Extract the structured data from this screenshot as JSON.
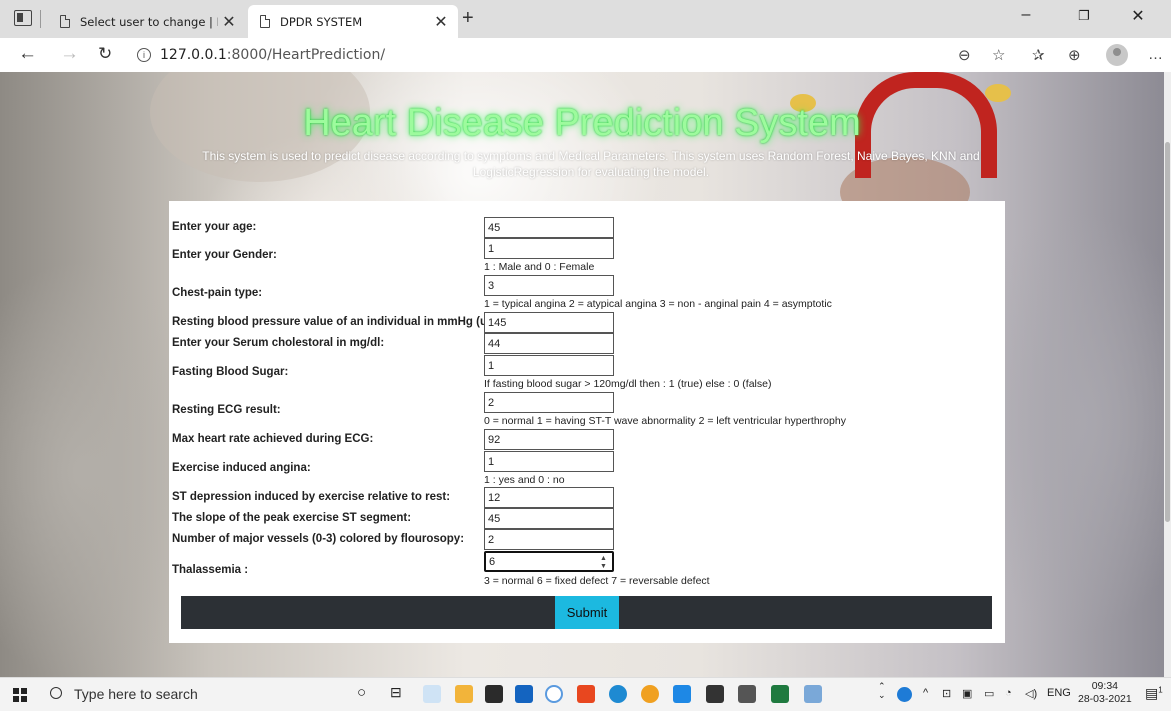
{
  "browser": {
    "tabs": [
      {
        "title": "Select user to change | Django si",
        "active": false
      },
      {
        "title": "DPDR SYSTEM",
        "active": true
      }
    ],
    "url_host": "127.0.0.1",
    "url_path": ":8000/HeartPrediction/"
  },
  "page": {
    "title": "Heart Disease Prediction System",
    "description": "This system is used to predict disease according to symptoms and Medical Parameters. This system uses Random Forest, Naive Bayes, KNN and LogisticRegression for evaluating the model."
  },
  "form": {
    "fields": [
      {
        "label": "Enter your age:",
        "value": "45",
        "hint": ""
      },
      {
        "label": "Enter your Gender:",
        "value": "1",
        "hint": "1 : Male and 0 : Female"
      },
      {
        "label": "Chest-pain type:",
        "value": "3",
        "hint": "1 = typical angina 2 = atypical angina 3 = non - anginal pain 4 = asymptotic"
      },
      {
        "label": "Resting blood pressure value of an individual in mmHg (unit):",
        "value": "145",
        "hint": ""
      },
      {
        "label": "Enter your Serum cholestoral in mg/dl:",
        "value": "44",
        "hint": ""
      },
      {
        "label": "Fasting Blood Sugar:",
        "value": "1",
        "hint": "If fasting blood sugar > 120mg/dl then : 1 (true) else : 0 (false)"
      },
      {
        "label": "Resting ECG result:",
        "value": "2",
        "hint": "0 = normal 1 = having ST-T wave abnormality 2 = left ventricular hyperthrophy"
      },
      {
        "label": "Max heart rate achieved during ECG:",
        "value": "92",
        "hint": ""
      },
      {
        "label": "Exercise induced angina:",
        "value": "1",
        "hint": "1 : yes and 0 : no"
      },
      {
        "label": "ST depression induced by exercise relative to rest:",
        "value": "12",
        "hint": ""
      },
      {
        "label": "The slope of the peak exercise ST segment:",
        "value": "45",
        "hint": ""
      },
      {
        "label": "Number of major vessels (0-3) colored by flourosopy:",
        "value": "2",
        "hint": ""
      },
      {
        "label": "Thalassemia :",
        "value": "6",
        "hint": "3 = normal 6 = fixed defect 7 = reversable defect"
      }
    ],
    "submit_label": "Submit"
  },
  "taskbar": {
    "search_placeholder": "Type here to search",
    "language": "ENG",
    "time": "09:34",
    "date": "28-03-2021",
    "notification_count": "1"
  },
  "colors": {
    "title_glow": "#9dfb9d",
    "submit_bg": "#1cb9e0",
    "submit_bar": "#2c3035"
  }
}
